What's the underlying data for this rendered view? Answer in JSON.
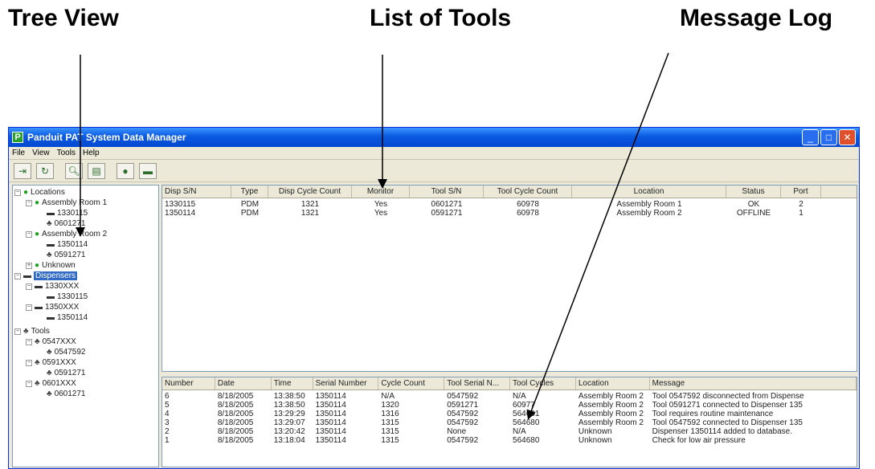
{
  "callouts": {
    "tree_view": "Tree View",
    "list_of_tools": "List of Tools",
    "message_log": "Message Log"
  },
  "window": {
    "title": "Panduit PAT System Data Manager",
    "icon_letter": "P",
    "controls": {
      "minimize": "_",
      "maximize": "□",
      "close": "✕"
    }
  },
  "menu": {
    "file": "File",
    "view": "View",
    "tools": "Tools",
    "help": "Help"
  },
  "toolbar": {
    "icons": [
      "exit-icon",
      "refresh-icon",
      "search-icon",
      "report-icon",
      "connect-icon",
      "tool-icon"
    ]
  },
  "tree": {
    "locations": "Locations",
    "room1": "Assembly Room 1",
    "room1_disp": "1330115",
    "room1_tool": "0601271",
    "room2": "Assembly Room 2",
    "room2_disp": "1350114",
    "room2_tool": "0591271",
    "unknown": "Unknown",
    "dispensers": "Dispensers",
    "d1_group": "1330XXX",
    "d1": "1330115",
    "d2_group": "1350XXX",
    "d2": "1350114",
    "tools": "Tools",
    "t1_group": "0547XXX",
    "t1": "0547592",
    "t2_group": "0591XXX",
    "t2": "0591271",
    "t3_group": "0601XXX",
    "t3": "0601271"
  },
  "tools_list": {
    "columns": [
      "Disp S/N",
      "Type",
      "Disp Cycle Count",
      "Monitor",
      "Tool S/N",
      "Tool Cycle Count",
      "Location",
      "Status",
      "Port"
    ],
    "rows": [
      [
        "1330115",
        "PDM",
        "1321",
        "Yes",
        "0601271",
        "60978",
        "Assembly Room 1",
        "OK",
        "2"
      ],
      [
        "1350114",
        "PDM",
        "1321",
        "Yes",
        "0591271",
        "60978",
        "Assembly Room 2",
        "OFFLINE",
        "1"
      ]
    ]
  },
  "message_log": {
    "columns": [
      "Number",
      "Date",
      "Time",
      "Serial Number",
      "Cycle Count",
      "Tool Serial N...",
      "Tool Cycles",
      "Location",
      "Message"
    ],
    "rows": [
      [
        "6",
        "8/18/2005",
        "13:38:50",
        "1350114",
        "N/A",
        "0547592",
        "N/A",
        "Assembly Room 2",
        "Tool 0547592 disconnected from Dispense"
      ],
      [
        "5",
        "8/18/2005",
        "13:38:50",
        "1350114",
        "1320",
        "0591271",
        "60977",
        "Assembly Room 2",
        "Tool 0591271 connected to Dispenser 135"
      ],
      [
        "4",
        "8/18/2005",
        "13:29:29",
        "1350114",
        "1316",
        "0547592",
        "564681",
        "Assembly Room 2",
        "Tool requires routine maintenance"
      ],
      [
        "3",
        "8/18/2005",
        "13:29:07",
        "1350114",
        "1315",
        "0547592",
        "564680",
        "Assembly Room 2",
        "Tool 0547592 connected to Dispenser 135"
      ],
      [
        "2",
        "8/18/2005",
        "13:20:42",
        "1350114",
        "1315",
        "None",
        "N/A",
        "Unknown",
        "Dispenser 1350114 added to database."
      ],
      [
        "1",
        "8/18/2005",
        "13:18:04",
        "1350114",
        "1315",
        "0547592",
        "564680",
        "Unknown",
        "Check for low air pressure"
      ]
    ]
  }
}
